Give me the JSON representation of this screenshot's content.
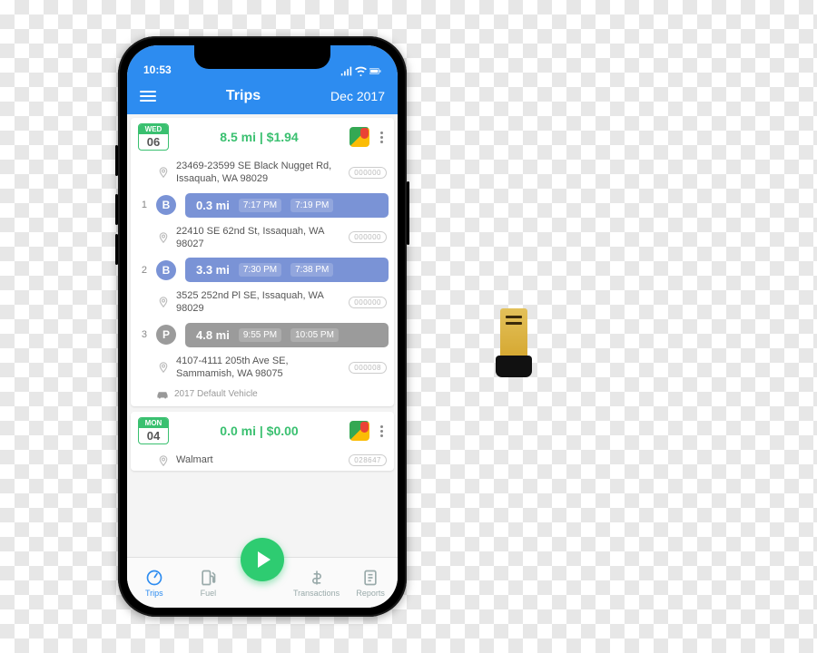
{
  "status_bar": {
    "time": "10:53"
  },
  "header": {
    "menu_label": "menu",
    "title": "Trips",
    "month": "Dec 2017"
  },
  "days": [
    {
      "dow": "WED",
      "dom": "06",
      "summary": "8.5 mi | $1.94",
      "stops": [
        {
          "address": "23469-23599 SE Black Nugget Rd, Issaquah, WA 98029",
          "odometer": "000000"
        },
        {
          "address": "22410 SE 62nd St, Issaquah, WA 98027",
          "odometer": "000000"
        },
        {
          "address": "3525 252nd Pl SE, Issaquah, WA 98029",
          "odometer": "000000"
        },
        {
          "address": "4107-4111 205th Ave SE, Sammamish, WA 98075",
          "odometer": "000008"
        }
      ],
      "segments": [
        {
          "idx": "1",
          "type": "B",
          "distance": "0.3 mi",
          "start": "7:17 PM",
          "end": "7:19 PM"
        },
        {
          "idx": "2",
          "type": "B",
          "distance": "3.3 mi",
          "start": "7:30 PM",
          "end": "7:38 PM"
        },
        {
          "idx": "3",
          "type": "P",
          "distance": "4.8 mi",
          "start": "9:55 PM",
          "end": "10:05 PM"
        }
      ],
      "vehicle": "2017 Default Vehicle"
    },
    {
      "dow": "MON",
      "dom": "04",
      "summary": "0.0 mi | $0.00",
      "stops": [
        {
          "address": "Walmart",
          "odometer": "028647"
        }
      ]
    }
  ],
  "nav": {
    "trips": "Trips",
    "fuel": "Fuel",
    "transactions": "Transactions",
    "reports": "Reports"
  }
}
